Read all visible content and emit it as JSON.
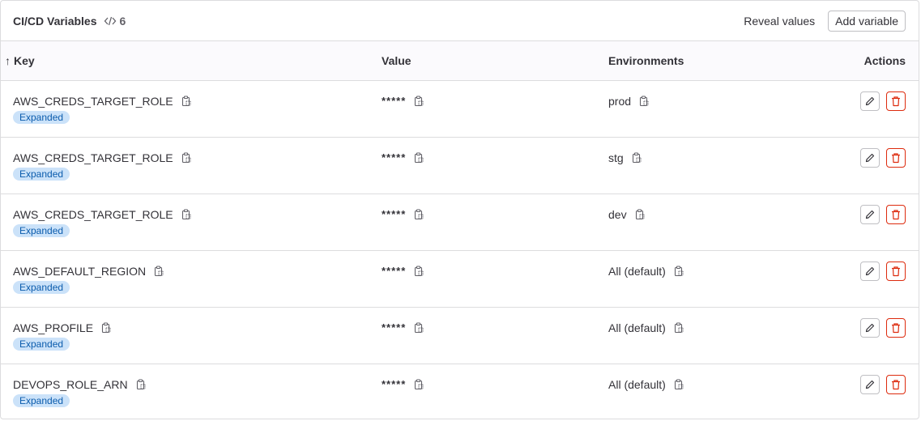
{
  "header": {
    "title": "CI/CD Variables",
    "count": "6",
    "count_icon": "code-icon",
    "reveal_label": "Reveal values",
    "add_label": "Add variable"
  },
  "columns": {
    "key": "Key",
    "value": "Value",
    "environments": "Environments",
    "actions": "Actions"
  },
  "rows": [
    {
      "key": "AWS_CREDS_TARGET_ROLE",
      "badge": "Expanded",
      "value": "*****",
      "env": "prod"
    },
    {
      "key": "AWS_CREDS_TARGET_ROLE",
      "badge": "Expanded",
      "value": "*****",
      "env": "stg"
    },
    {
      "key": "AWS_CREDS_TARGET_ROLE",
      "badge": "Expanded",
      "value": "*****",
      "env": "dev"
    },
    {
      "key": "AWS_DEFAULT_REGION",
      "badge": "Expanded",
      "value": "*****",
      "env": "All (default)"
    },
    {
      "key": "AWS_PROFILE",
      "badge": "Expanded",
      "value": "*****",
      "env": "All (default)"
    },
    {
      "key": "DEVOPS_ROLE_ARN",
      "badge": "Expanded",
      "value": "*****",
      "env": "All (default)"
    }
  ],
  "colors": {
    "badge_bg": "#cbe2f9",
    "badge_text": "#0b5cad",
    "danger": "#dd2b0e"
  }
}
